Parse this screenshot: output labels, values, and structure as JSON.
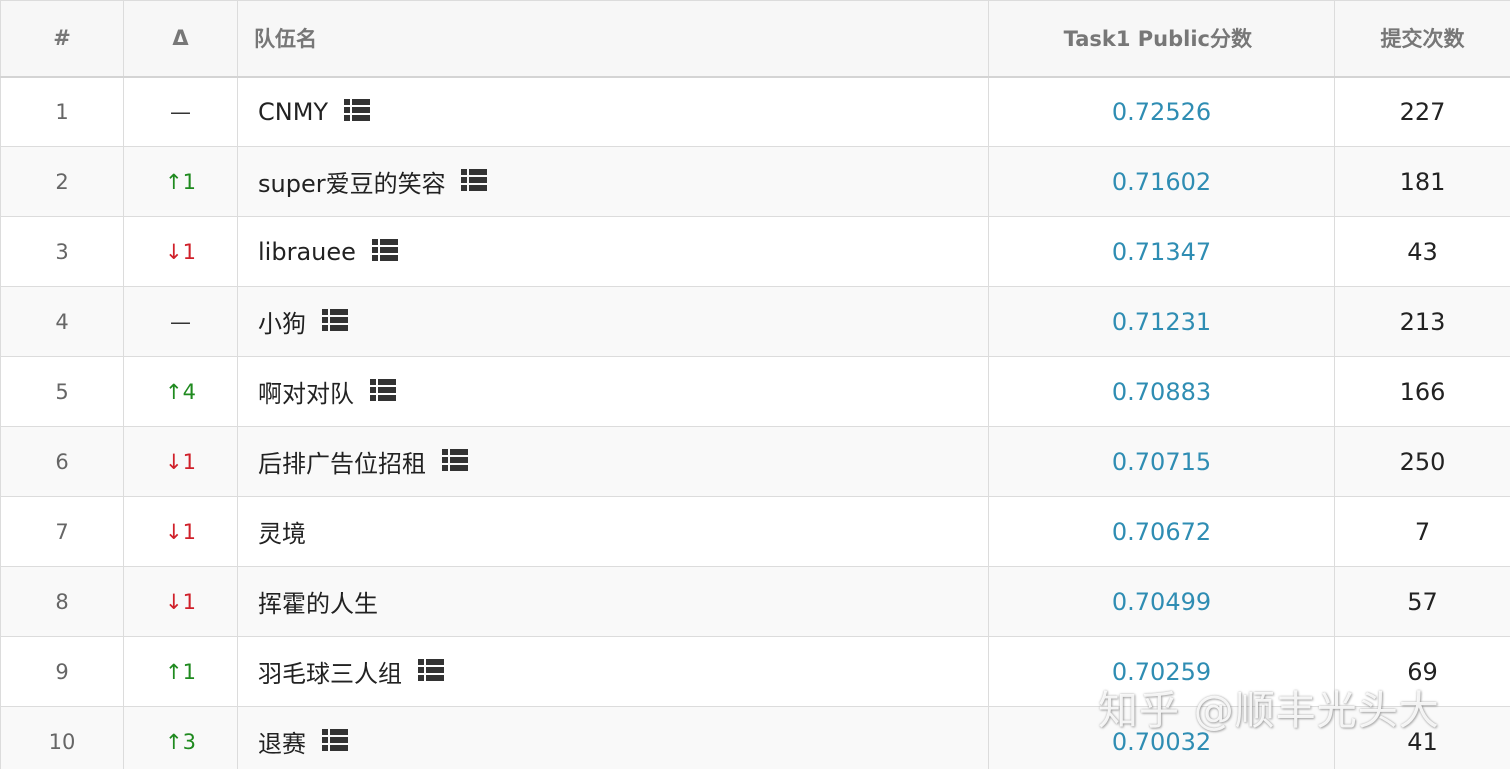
{
  "headers": {
    "rank": "#",
    "delta": "Δ",
    "team": "队伍名",
    "score": "Task1 Public分数",
    "submissions": "提交次数"
  },
  "colors": {
    "score_link": "#2f8db3",
    "up": "#1f8a1f",
    "down": "#d0202a"
  },
  "rows": [
    {
      "rank": "1",
      "delta": "—",
      "delta_dir": "same",
      "team": "CNMY",
      "has_list_icon": true,
      "score": "0.72526",
      "submissions": "227"
    },
    {
      "rank": "2",
      "delta": "↑1",
      "delta_dir": "up",
      "team": "super爱豆的笑容",
      "has_list_icon": true,
      "score": "0.71602",
      "submissions": "181"
    },
    {
      "rank": "3",
      "delta": "↓1",
      "delta_dir": "down",
      "team": "librauee",
      "has_list_icon": true,
      "score": "0.71347",
      "submissions": "43"
    },
    {
      "rank": "4",
      "delta": "—",
      "delta_dir": "same",
      "team": "小狗",
      "has_list_icon": true,
      "score": "0.71231",
      "submissions": "213"
    },
    {
      "rank": "5",
      "delta": "↑4",
      "delta_dir": "up",
      "team": "啊对对队",
      "has_list_icon": true,
      "score": "0.70883",
      "submissions": "166"
    },
    {
      "rank": "6",
      "delta": "↓1",
      "delta_dir": "down",
      "team": "后排广告位招租",
      "has_list_icon": true,
      "score": "0.70715",
      "submissions": "250"
    },
    {
      "rank": "7",
      "delta": "↓1",
      "delta_dir": "down",
      "team": "灵境",
      "has_list_icon": false,
      "score": "0.70672",
      "submissions": "7"
    },
    {
      "rank": "8",
      "delta": "↓1",
      "delta_dir": "down",
      "team": "挥霍的人生",
      "has_list_icon": false,
      "score": "0.70499",
      "submissions": "57"
    },
    {
      "rank": "9",
      "delta": "↑1",
      "delta_dir": "up",
      "team": "羽毛球三人组",
      "has_list_icon": true,
      "score": "0.70259",
      "submissions": "69"
    },
    {
      "rank": "10",
      "delta": "↑3",
      "delta_dir": "up",
      "team": "退赛",
      "has_list_icon": true,
      "score": "0.70032",
      "submissions": "41"
    }
  ],
  "watermark": "知乎 @顺丰光头大"
}
